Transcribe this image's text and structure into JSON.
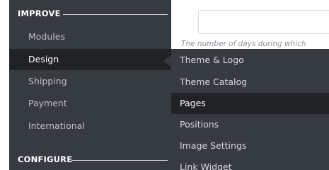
{
  "sidebar": {
    "sections": [
      {
        "title": "IMPROVE"
      },
      {
        "title": "CONFIGURE"
      }
    ],
    "items": [
      {
        "label": "Modules"
      },
      {
        "label": "Design"
      },
      {
        "label": "Shipping"
      },
      {
        "label": "Payment"
      },
      {
        "label": "International"
      }
    ],
    "active_item": "Design"
  },
  "main": {
    "input_value": "",
    "help_text": "The number of days during which"
  },
  "submenu": {
    "items": [
      {
        "label": "Theme & Logo"
      },
      {
        "label": "Theme Catalog"
      },
      {
        "label": "Pages"
      },
      {
        "label": "Positions"
      },
      {
        "label": "Image Settings"
      },
      {
        "label": "Link Widget"
      }
    ],
    "active_item": "Pages"
  },
  "colors": {
    "sidebar_bg": "#363a41",
    "active_bg": "#202226",
    "text_muted": "#bcc0c6",
    "text_active": "#ffffff"
  }
}
